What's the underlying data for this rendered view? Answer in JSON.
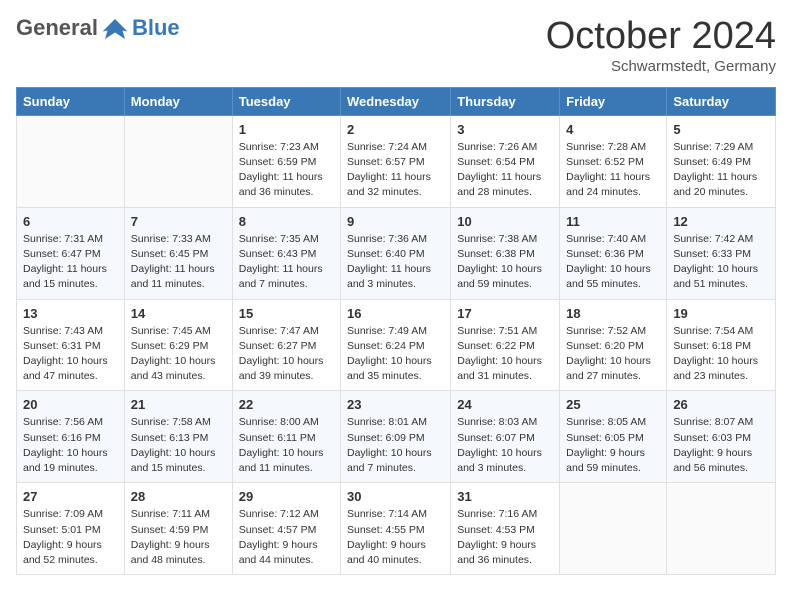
{
  "header": {
    "logo_line1": "General",
    "logo_line2": "Blue",
    "month": "October 2024",
    "location": "Schwarmstedt, Germany"
  },
  "weekdays": [
    "Sunday",
    "Monday",
    "Tuesday",
    "Wednesday",
    "Thursday",
    "Friday",
    "Saturday"
  ],
  "weeks": [
    [
      {
        "day": "",
        "sunrise": "",
        "sunset": "",
        "daylight": ""
      },
      {
        "day": "",
        "sunrise": "",
        "sunset": "",
        "daylight": ""
      },
      {
        "day": "1",
        "sunrise": "Sunrise: 7:23 AM",
        "sunset": "Sunset: 6:59 PM",
        "daylight": "Daylight: 11 hours and 36 minutes."
      },
      {
        "day": "2",
        "sunrise": "Sunrise: 7:24 AM",
        "sunset": "Sunset: 6:57 PM",
        "daylight": "Daylight: 11 hours and 32 minutes."
      },
      {
        "day": "3",
        "sunrise": "Sunrise: 7:26 AM",
        "sunset": "Sunset: 6:54 PM",
        "daylight": "Daylight: 11 hours and 28 minutes."
      },
      {
        "day": "4",
        "sunrise": "Sunrise: 7:28 AM",
        "sunset": "Sunset: 6:52 PM",
        "daylight": "Daylight: 11 hours and 24 minutes."
      },
      {
        "day": "5",
        "sunrise": "Sunrise: 7:29 AM",
        "sunset": "Sunset: 6:49 PM",
        "daylight": "Daylight: 11 hours and 20 minutes."
      }
    ],
    [
      {
        "day": "6",
        "sunrise": "Sunrise: 7:31 AM",
        "sunset": "Sunset: 6:47 PM",
        "daylight": "Daylight: 11 hours and 15 minutes."
      },
      {
        "day": "7",
        "sunrise": "Sunrise: 7:33 AM",
        "sunset": "Sunset: 6:45 PM",
        "daylight": "Daylight: 11 hours and 11 minutes."
      },
      {
        "day": "8",
        "sunrise": "Sunrise: 7:35 AM",
        "sunset": "Sunset: 6:43 PM",
        "daylight": "Daylight: 11 hours and 7 minutes."
      },
      {
        "day": "9",
        "sunrise": "Sunrise: 7:36 AM",
        "sunset": "Sunset: 6:40 PM",
        "daylight": "Daylight: 11 hours and 3 minutes."
      },
      {
        "day": "10",
        "sunrise": "Sunrise: 7:38 AM",
        "sunset": "Sunset: 6:38 PM",
        "daylight": "Daylight: 10 hours and 59 minutes."
      },
      {
        "day": "11",
        "sunrise": "Sunrise: 7:40 AM",
        "sunset": "Sunset: 6:36 PM",
        "daylight": "Daylight: 10 hours and 55 minutes."
      },
      {
        "day": "12",
        "sunrise": "Sunrise: 7:42 AM",
        "sunset": "Sunset: 6:33 PM",
        "daylight": "Daylight: 10 hours and 51 minutes."
      }
    ],
    [
      {
        "day": "13",
        "sunrise": "Sunrise: 7:43 AM",
        "sunset": "Sunset: 6:31 PM",
        "daylight": "Daylight: 10 hours and 47 minutes."
      },
      {
        "day": "14",
        "sunrise": "Sunrise: 7:45 AM",
        "sunset": "Sunset: 6:29 PM",
        "daylight": "Daylight: 10 hours and 43 minutes."
      },
      {
        "day": "15",
        "sunrise": "Sunrise: 7:47 AM",
        "sunset": "Sunset: 6:27 PM",
        "daylight": "Daylight: 10 hours and 39 minutes."
      },
      {
        "day": "16",
        "sunrise": "Sunrise: 7:49 AM",
        "sunset": "Sunset: 6:24 PM",
        "daylight": "Daylight: 10 hours and 35 minutes."
      },
      {
        "day": "17",
        "sunrise": "Sunrise: 7:51 AM",
        "sunset": "Sunset: 6:22 PM",
        "daylight": "Daylight: 10 hours and 31 minutes."
      },
      {
        "day": "18",
        "sunrise": "Sunrise: 7:52 AM",
        "sunset": "Sunset: 6:20 PM",
        "daylight": "Daylight: 10 hours and 27 minutes."
      },
      {
        "day": "19",
        "sunrise": "Sunrise: 7:54 AM",
        "sunset": "Sunset: 6:18 PM",
        "daylight": "Daylight: 10 hours and 23 minutes."
      }
    ],
    [
      {
        "day": "20",
        "sunrise": "Sunrise: 7:56 AM",
        "sunset": "Sunset: 6:16 PM",
        "daylight": "Daylight: 10 hours and 19 minutes."
      },
      {
        "day": "21",
        "sunrise": "Sunrise: 7:58 AM",
        "sunset": "Sunset: 6:13 PM",
        "daylight": "Daylight: 10 hours and 15 minutes."
      },
      {
        "day": "22",
        "sunrise": "Sunrise: 8:00 AM",
        "sunset": "Sunset: 6:11 PM",
        "daylight": "Daylight: 10 hours and 11 minutes."
      },
      {
        "day": "23",
        "sunrise": "Sunrise: 8:01 AM",
        "sunset": "Sunset: 6:09 PM",
        "daylight": "Daylight: 10 hours and 7 minutes."
      },
      {
        "day": "24",
        "sunrise": "Sunrise: 8:03 AM",
        "sunset": "Sunset: 6:07 PM",
        "daylight": "Daylight: 10 hours and 3 minutes."
      },
      {
        "day": "25",
        "sunrise": "Sunrise: 8:05 AM",
        "sunset": "Sunset: 6:05 PM",
        "daylight": "Daylight: 9 hours and 59 minutes."
      },
      {
        "day": "26",
        "sunrise": "Sunrise: 8:07 AM",
        "sunset": "Sunset: 6:03 PM",
        "daylight": "Daylight: 9 hours and 56 minutes."
      }
    ],
    [
      {
        "day": "27",
        "sunrise": "Sunrise: 7:09 AM",
        "sunset": "Sunset: 5:01 PM",
        "daylight": "Daylight: 9 hours and 52 minutes."
      },
      {
        "day": "28",
        "sunrise": "Sunrise: 7:11 AM",
        "sunset": "Sunset: 4:59 PM",
        "daylight": "Daylight: 9 hours and 48 minutes."
      },
      {
        "day": "29",
        "sunrise": "Sunrise: 7:12 AM",
        "sunset": "Sunset: 4:57 PM",
        "daylight": "Daylight: 9 hours and 44 minutes."
      },
      {
        "day": "30",
        "sunrise": "Sunrise: 7:14 AM",
        "sunset": "Sunset: 4:55 PM",
        "daylight": "Daylight: 9 hours and 40 minutes."
      },
      {
        "day": "31",
        "sunrise": "Sunrise: 7:16 AM",
        "sunset": "Sunset: 4:53 PM",
        "daylight": "Daylight: 9 hours and 36 minutes."
      },
      {
        "day": "",
        "sunrise": "",
        "sunset": "",
        "daylight": ""
      },
      {
        "day": "",
        "sunrise": "",
        "sunset": "",
        "daylight": ""
      }
    ]
  ]
}
